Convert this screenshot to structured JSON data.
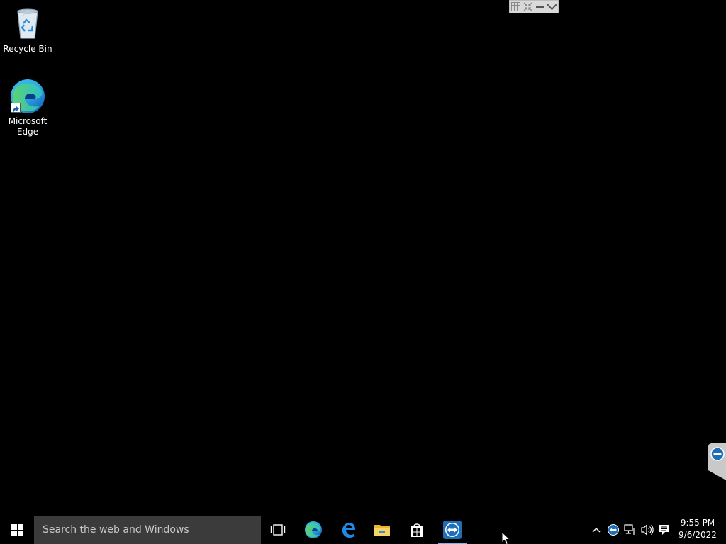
{
  "desktop": {
    "icons": [
      {
        "name": "recycle-bin",
        "label": "Recycle Bin"
      },
      {
        "name": "microsoft-edge",
        "label": "Microsoft\nEdge"
      }
    ]
  },
  "teamviewer_toolbar": {
    "buttons": [
      "grid-icon",
      "compress-icon",
      "minimize-icon",
      "chevron-down-icon"
    ]
  },
  "taskbar": {
    "search_placeholder": "Search the web and Windows",
    "pinned": [
      "task-view",
      "microsoft-edge",
      "internet-edge-legacy",
      "file-explorer",
      "store",
      "teamviewer"
    ],
    "active_app": "teamviewer",
    "accent_color": "#7fb2e5"
  },
  "tray": {
    "time": "9:55 PM",
    "date": "9/6/2022",
    "icons": [
      "chevron-up-icon",
      "teamviewer-icon",
      "network-icon",
      "volume-icon",
      "notification-icon"
    ]
  }
}
